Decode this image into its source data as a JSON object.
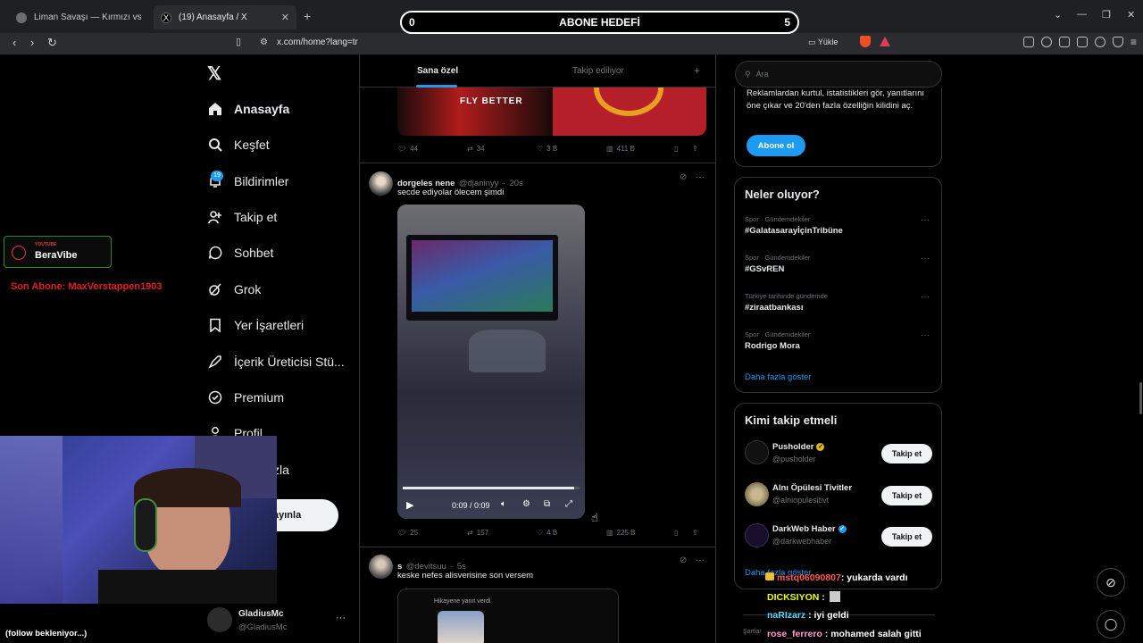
{
  "browser": {
    "tabs": [
      {
        "title": "Liman Savaşı — Kırmızı vs Mavi"
      },
      {
        "title": "(19) Anasayfa / X"
      }
    ],
    "url": "x.com/home?lang=tr",
    "install_label": "Yükle"
  },
  "overlay": {
    "goal": {
      "left": "0",
      "title": "ABONE HEDEFİ",
      "right": "5"
    },
    "channel": {
      "platform": "YOUTUBE",
      "name": "BeraVibe"
    },
    "last_sub": "Son Abone: MaxVerstappen1903",
    "follow_status": "(follow bekleniyor...)",
    "chat": [
      {
        "user": "mstq06090807",
        "msg": ": yukarda vardı",
        "color": "#ff5a5a"
      },
      {
        "user": "DICKSIYON",
        "msg": " :",
        "color": "#eaff00"
      },
      {
        "user": "naRIzarz",
        "msg": " : iyi geldi",
        "color": "#5ad8ff"
      },
      {
        "user": "rose_ferrero",
        "msg": " : mohamed salah gitti",
        "color": "#ff9ecf"
      }
    ]
  },
  "nav": {
    "items": [
      {
        "label": "Anasayfa",
        "icon": "home-icon"
      },
      {
        "label": "Keşfet",
        "icon": "search-icon"
      },
      {
        "label": "Bildirimler",
        "icon": "bell-icon"
      },
      {
        "label": "Takip et",
        "icon": "add-user-icon"
      },
      {
        "label": "Sohbet",
        "icon": "chat-icon"
      },
      {
        "label": "Grok",
        "icon": "grok-icon"
      },
      {
        "label": "Yer İşaretleri",
        "icon": "bookmark-icon"
      },
      {
        "label": "İçerik Üreticisi Stü...",
        "icon": "rocket-icon"
      },
      {
        "label": "Premium",
        "icon": "premium-icon"
      },
      {
        "label": "Profil",
        "icon": "profile-icon"
      },
      {
        "label": "zla",
        "icon": "more-icon"
      }
    ],
    "notif_count": "19",
    "post_button": "ayınla",
    "account": {
      "name": "GladiusMc",
      "handle": "@GladiusMc"
    }
  },
  "main": {
    "tabs": [
      "Sana özel",
      "Takip ediliyor"
    ],
    "top_post": {
      "image_text": "FLY BETTER",
      "stats": {
        "replies": "44",
        "reposts": "34",
        "likes": "3 B",
        "views": "411 B"
      }
    },
    "post1": {
      "name": "dorgeles nene",
      "handle": "@djaninyy",
      "time": "20s",
      "text": "secde ediyolar ölecem şimdi",
      "video": {
        "progress": 0.97,
        "time": "0:09 / 0:09"
      },
      "stats": {
        "replies": "25",
        "reposts": "157",
        "likes": "4 B",
        "views": "225 B"
      }
    },
    "post2": {
      "name": "s",
      "handle": "@devitsuu",
      "time": "5s",
      "text": "keske nefes alisverisine son versem",
      "quote": "Hikayene yanıt verdi"
    }
  },
  "right": {
    "search_placeholder": "Ara",
    "premium": {
      "text": "Reklamlardan kurtul, istatistikleri gör, yanıtlarını öne çıkar ve 20'den fazla özelliğin kilidini aç.",
      "button": "Abone ol"
    },
    "trends": {
      "title": "Neler oluyor?",
      "items": [
        {
          "cat": "Spor · Gündemdekiler",
          "name": "#GalatasarayİçinTribüne"
        },
        {
          "cat": "Spor · Gündemdekiler",
          "name": "#GSvREN"
        },
        {
          "cat": "Türkiye tarihinde gündemde",
          "name": "#ziraatbankası"
        },
        {
          "cat": "Spor · Gündemdekiler",
          "name": "Rodrigo Mora"
        }
      ],
      "more": "Daha fazla göster"
    },
    "who": {
      "title": "Kimi takip etmeli",
      "items": [
        {
          "name": "Pusholder",
          "handle": "@pusholder",
          "verified": "gold"
        },
        {
          "name": "Alnı Öpülesi Tivitler",
          "handle": "@alniopulesitivt",
          "verified": ""
        },
        {
          "name": "DarkWeb Haber",
          "handle": "@darkwebhaber",
          "verified": "blue"
        }
      ],
      "button": "Takip et",
      "more": "Daha fazla göster"
    },
    "footer": "Şartlar"
  },
  "colors": {
    "accent": "#1d9bf0",
    "border": "#2f3336",
    "muted": "#71767b"
  }
}
